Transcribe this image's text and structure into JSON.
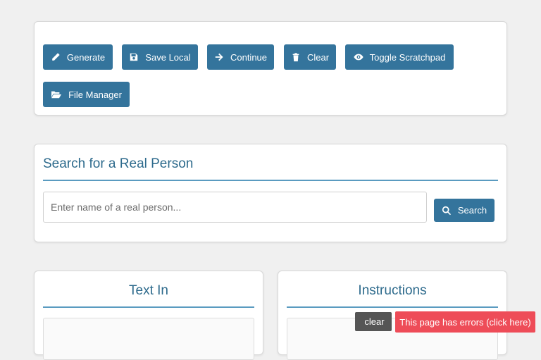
{
  "toolbar": {
    "buttons": [
      {
        "label": "Generate",
        "icon": "pencil-icon"
      },
      {
        "label": "Save Local",
        "icon": "save-icon"
      },
      {
        "label": "Continue",
        "icon": "arrow-right-icon"
      },
      {
        "label": "Clear",
        "icon": "trash-icon"
      },
      {
        "label": "Toggle Scratchpad",
        "icon": "eye-icon"
      },
      {
        "label": "File Manager",
        "icon": "folder-open-icon"
      }
    ]
  },
  "search": {
    "title": "Search for a Real Person",
    "placeholder": "Enter name of a real person...",
    "button_label": "Search",
    "button_icon": "search-icon"
  },
  "text_in": {
    "title": "Text In"
  },
  "instructions": {
    "title": "Instructions"
  },
  "overlay": {
    "clear_label": "clear",
    "clear_glyph": "",
    "errors_label": "This page has errors (click here)"
  },
  "colors": {
    "button": "#34749c",
    "heading": "#2d6a8c",
    "rule": "#5a9bc0",
    "error": "#ee4c58",
    "background": "#f0f0f0"
  }
}
